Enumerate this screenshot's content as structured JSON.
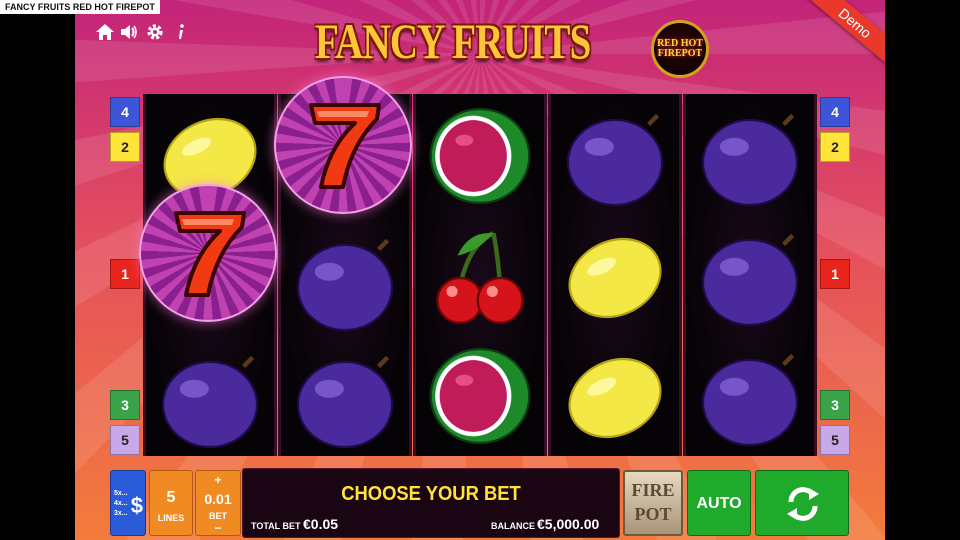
{
  "window_title": "FANCY FRUITS RED HOT FIREPOT",
  "top_icons": [
    "home-icon",
    "speaker-icon",
    "gear-icon",
    "info-icon"
  ],
  "logo": {
    "title": "FANCY FRUITS",
    "badge_line1": "RED HOT",
    "badge_line2": "FIREPOT"
  },
  "demo_label": "Demo",
  "paylines_left": [
    "4",
    "2",
    "1",
    "3",
    "5"
  ],
  "paylines_right": [
    "4",
    "2",
    "1",
    "3",
    "5"
  ],
  "payline_colors": {
    "1": "#e8241d",
    "2": "#ffe53a",
    "3": "#3aa34a",
    "4": "#3d55d6",
    "5": "#c8a8e8"
  },
  "reels": [
    [
      "lemon",
      "seven (expanded)",
      "plum"
    ],
    [
      "seven (expanded)",
      "plum",
      "plum"
    ],
    [
      "watermelon",
      "cherries",
      "watermelon"
    ],
    [
      "plum",
      "lemon",
      "lemon"
    ],
    [
      "plum",
      "plum",
      "plum"
    ]
  ],
  "controls": {
    "multiplier_lines": [
      "5x...",
      "4x...",
      "3x..."
    ],
    "currency_symbol": "$",
    "lines_value": "5",
    "lines_label": "LINES",
    "bet_plus": "+",
    "bet_value": "0.01",
    "bet_label": "BET",
    "bet_minus": "−",
    "message": "CHOOSE YOUR BET",
    "total_bet_label": "TOTAL BET",
    "total_bet_value": "€0.05",
    "balance_label": "BALANCE",
    "balance_value": "€5,000.00",
    "firepot_line1": "FIRE",
    "firepot_line2": "POT",
    "auto_label": "AUTO"
  }
}
